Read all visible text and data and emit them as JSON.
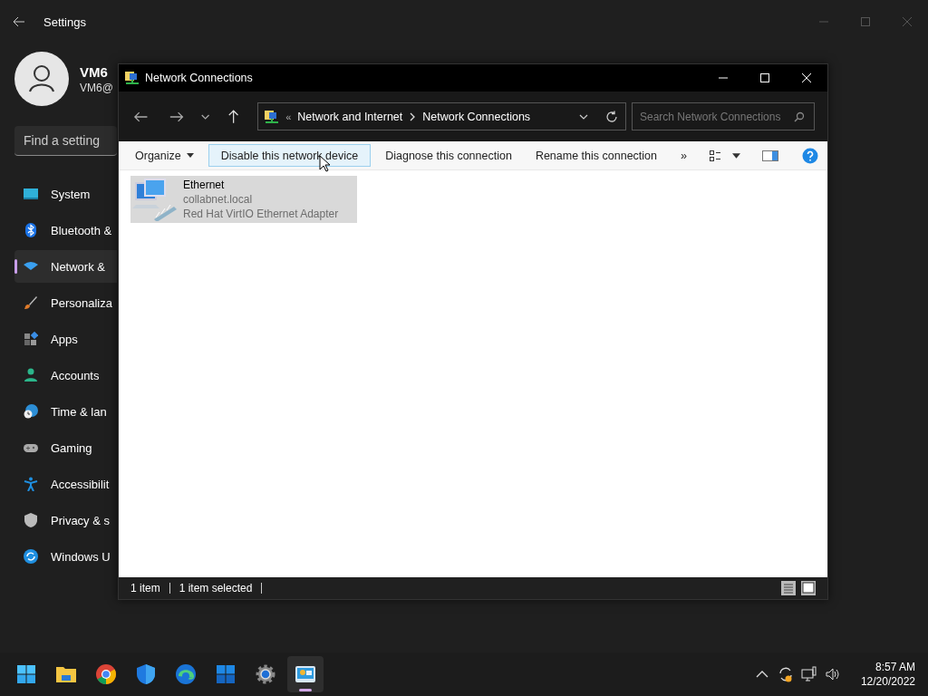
{
  "settings": {
    "title": "Settings",
    "profile": {
      "name": "VM6",
      "email": "VM6@"
    },
    "search": {
      "placeholder": "Find a setting"
    },
    "nav": [
      {
        "label": "System",
        "kind": "system",
        "selected": false
      },
      {
        "label": "Bluetooth &",
        "kind": "bluetooth",
        "selected": false
      },
      {
        "label": "Network &",
        "kind": "network",
        "selected": true
      },
      {
        "label": "Personaliza",
        "kind": "brush",
        "selected": false
      },
      {
        "label": "Apps",
        "kind": "apps",
        "selected": false
      },
      {
        "label": "Accounts",
        "kind": "accounts",
        "selected": false
      },
      {
        "label": "Time & lan",
        "kind": "time",
        "selected": false
      },
      {
        "label": "Gaming",
        "kind": "gaming",
        "selected": false
      },
      {
        "label": "Accessibilit",
        "kind": "accessibility",
        "selected": false
      },
      {
        "label": "Privacy & s",
        "kind": "privacy",
        "selected": false
      },
      {
        "label": "Windows U",
        "kind": "update",
        "selected": false
      }
    ]
  },
  "window": {
    "title": "Network Connections",
    "address": {
      "prefix": "«",
      "crumbs": [
        "Network and Internet",
        "Network Connections"
      ]
    },
    "search": {
      "placeholder": "Search Network Connections"
    },
    "commands": [
      {
        "label": "Organize",
        "kind": "menu",
        "hovered": false
      },
      {
        "label": "Disable this network device",
        "kind": "action",
        "hovered": true
      },
      {
        "label": "Diagnose this connection",
        "kind": "action",
        "hovered": false
      },
      {
        "label": "Rename this connection",
        "kind": "action",
        "hovered": false
      },
      {
        "label": "»",
        "kind": "more",
        "hovered": false
      }
    ],
    "items": [
      {
        "name": "Ethernet",
        "domain": "collabnet.local",
        "adapter": "Red Hat VirtIO Ethernet Adapter",
        "selected": true
      }
    ],
    "status": [
      "1 item",
      "1 item selected"
    ]
  },
  "taskbar": {
    "apps": [
      {
        "kind": "start",
        "selected": false
      },
      {
        "kind": "folder",
        "selected": false
      },
      {
        "kind": "chrome",
        "selected": false
      },
      {
        "kind": "shield",
        "selected": false
      },
      {
        "kind": "edge",
        "selected": false
      },
      {
        "kind": "store",
        "selected": false
      },
      {
        "kind": "gear",
        "selected": false
      },
      {
        "kind": "network",
        "selected": true
      }
    ],
    "clock": {
      "time": "8:57 AM",
      "date": "12/20/2022"
    }
  }
}
